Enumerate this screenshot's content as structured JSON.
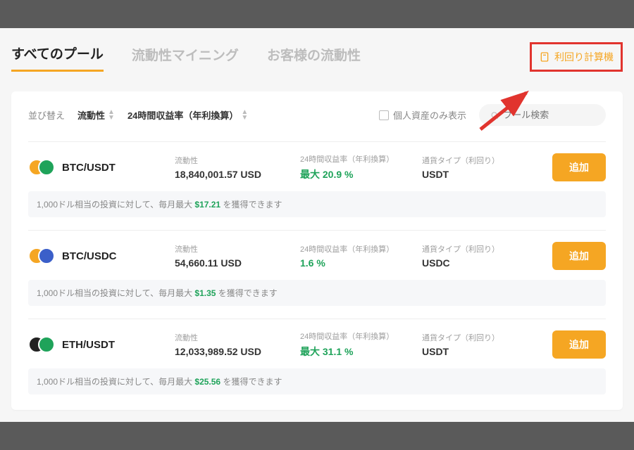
{
  "tabs": {
    "all_pools": "すべてのプール",
    "liquidity_mining": "流動性マイニング",
    "your_liquidity": "お客様の流動性"
  },
  "calc_button": "利回り計算機",
  "sort": {
    "label": "並び替え",
    "by_liquidity": "流動性",
    "by_apy": "24時間収益率（年利換算）"
  },
  "personal_only": "個人資産のみ表示",
  "search_placeholder": "プール検索",
  "col_labels": {
    "liquidity": "流動性",
    "apy": "24時間収益率（年利換算）",
    "reward_asset": "通貨タイプ（利回り）"
  },
  "add_label": "追加",
  "note_prefix": "1,000ドル相当の投資に対して、毎月最大 ",
  "note_suffix": " を獲得できます",
  "pools": [
    {
      "pair": "BTC/USDT",
      "c1_color": "#f5a623",
      "c2_color": "#1fa35a",
      "liquidity": "18,840,001.57 USD",
      "apy": "最大 20.9 %",
      "reward": "USDT",
      "note_amt": "$17.21"
    },
    {
      "pair": "BTC/USDC",
      "c1_color": "#f5a623",
      "c2_color": "#3b5fc9",
      "liquidity": "54,660.11 USD",
      "apy": "1.6 %",
      "reward": "USDC",
      "note_amt": "$1.35"
    },
    {
      "pair": "ETH/USDT",
      "c1_color": "#222222",
      "c2_color": "#1fa35a",
      "liquidity": "12,033,989.52 USD",
      "apy": "最大 31.1 %",
      "reward": "USDT",
      "note_amt": "$25.56"
    }
  ]
}
